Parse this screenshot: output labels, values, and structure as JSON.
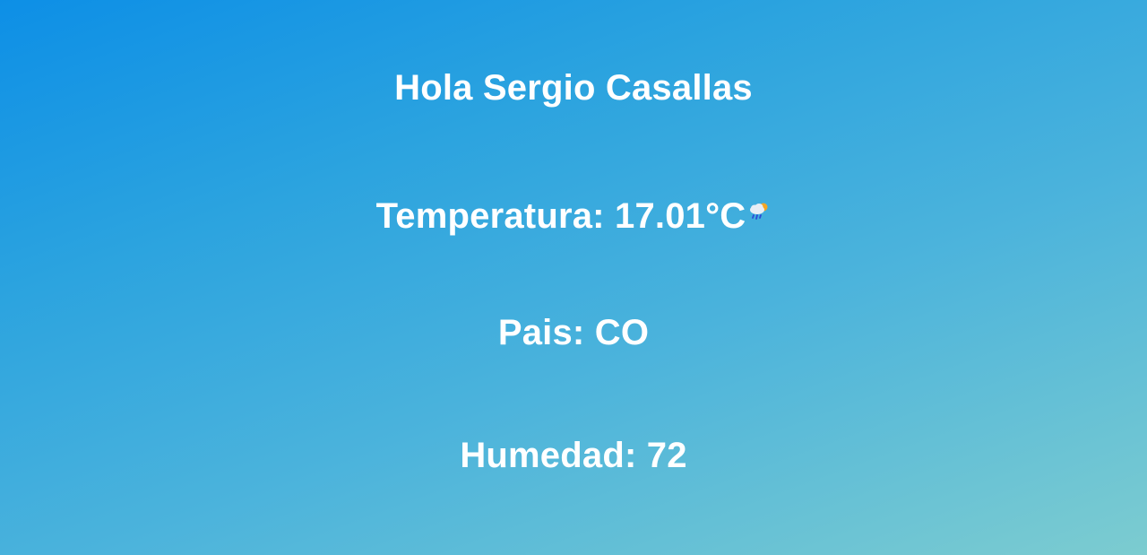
{
  "greeting": "Hola Sergio Casallas",
  "temperature": {
    "text": "Temperatura: 17.01°C",
    "icon": "cloud-rain-sun-icon"
  },
  "country": "Pais: CO",
  "humidity": "Humedad: 72",
  "colors": {
    "gradient_start": "#0d8fe6",
    "gradient_end": "#7cccd0",
    "text": "#ffffff"
  }
}
